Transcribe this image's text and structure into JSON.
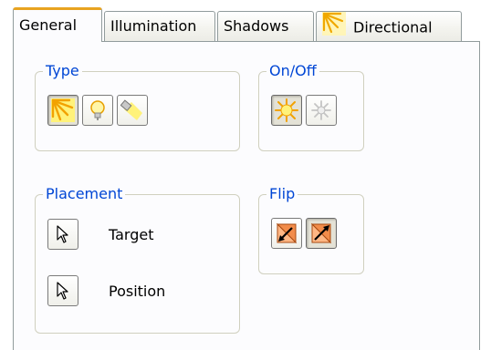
{
  "tabs": [
    {
      "label": "General",
      "active": true
    },
    {
      "label": "Illumination",
      "active": false
    },
    {
      "label": "Shadows",
      "active": false
    },
    {
      "label": "Directional",
      "active": false,
      "icon": "directional-light-icon"
    }
  ],
  "groups": {
    "type": {
      "label": "Type",
      "buttons": [
        {
          "icon": "directional-light-icon",
          "pressed": true
        },
        {
          "icon": "point-light-bulb-icon",
          "pressed": false
        },
        {
          "icon": "spotlight-icon",
          "pressed": false
        }
      ]
    },
    "onoff": {
      "label": "On/Off",
      "buttons": [
        {
          "icon": "light-on-icon",
          "pressed": true
        },
        {
          "icon": "light-off-icon",
          "pressed": false
        }
      ]
    },
    "placement": {
      "label": "Placement",
      "rows": [
        {
          "label": "Target",
          "icon": "select-arrow-icon"
        },
        {
          "label": "Position",
          "icon": "select-arrow-icon"
        }
      ]
    },
    "flip": {
      "label": "Flip",
      "buttons": [
        {
          "icon": "flip-to-target-icon",
          "pressed": false
        },
        {
          "icon": "flip-to-source-icon",
          "pressed": true
        }
      ]
    }
  },
  "colors": {
    "group_label": "#0046d5",
    "active_tab_accent": "#e8a320",
    "border": "#919b9c"
  }
}
